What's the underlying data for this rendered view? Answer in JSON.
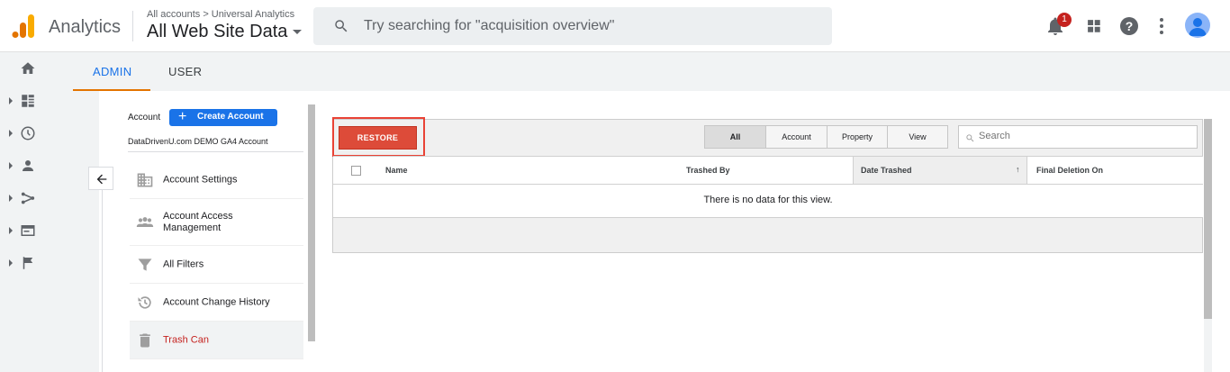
{
  "header": {
    "app_name": "Analytics",
    "breadcrumb": {
      "parent": "All accounts",
      "separator": ">",
      "child": "Universal Analytics"
    },
    "property_name": "All Web Site Data",
    "search_placeholder": "Try searching for \"acquisition overview\"",
    "notification_count": "1",
    "icons": [
      "notifications-icon",
      "apps-icon",
      "help-icon",
      "more-vert-icon",
      "avatar"
    ]
  },
  "leftnav": {
    "items": [
      "home-icon",
      "customization-icon",
      "realtime-icon",
      "audience-icon",
      "acquisition-icon",
      "behavior-icon",
      "conversions-icon"
    ]
  },
  "tabs": {
    "admin": "ADMIN",
    "user": "USER"
  },
  "account": {
    "label": "Account",
    "create_button": "Create Account",
    "create_plus": "+",
    "name": "DataDrivenU.com DEMO GA4 Account"
  },
  "menu": [
    {
      "label": "Account Settings",
      "icon": "building-icon"
    },
    {
      "label": "Account Access Management",
      "icon": "people-icon"
    },
    {
      "label": "All Filters",
      "icon": "filter-icon"
    },
    {
      "label": "Account Change History",
      "icon": "history-icon"
    },
    {
      "label": "Trash Can",
      "icon": "trash-icon",
      "active": true
    }
  ],
  "trash": {
    "restore_button": "RESTORE",
    "filters": [
      "All",
      "Account",
      "Property",
      "View"
    ],
    "selected_filter": "All",
    "search_placeholder": "Search",
    "columns": [
      "Name",
      "Trashed By",
      "Date Trashed",
      "Final Deletion On"
    ],
    "sort_indicator": "↑",
    "empty_message": "There is no data for this view."
  },
  "colors": {
    "accent_blue": "#1a73e8",
    "tab_underline": "#e37400",
    "restore_red": "#dd4b39",
    "highlight_outline": "#e94235",
    "active_menu": "#c5221f"
  }
}
